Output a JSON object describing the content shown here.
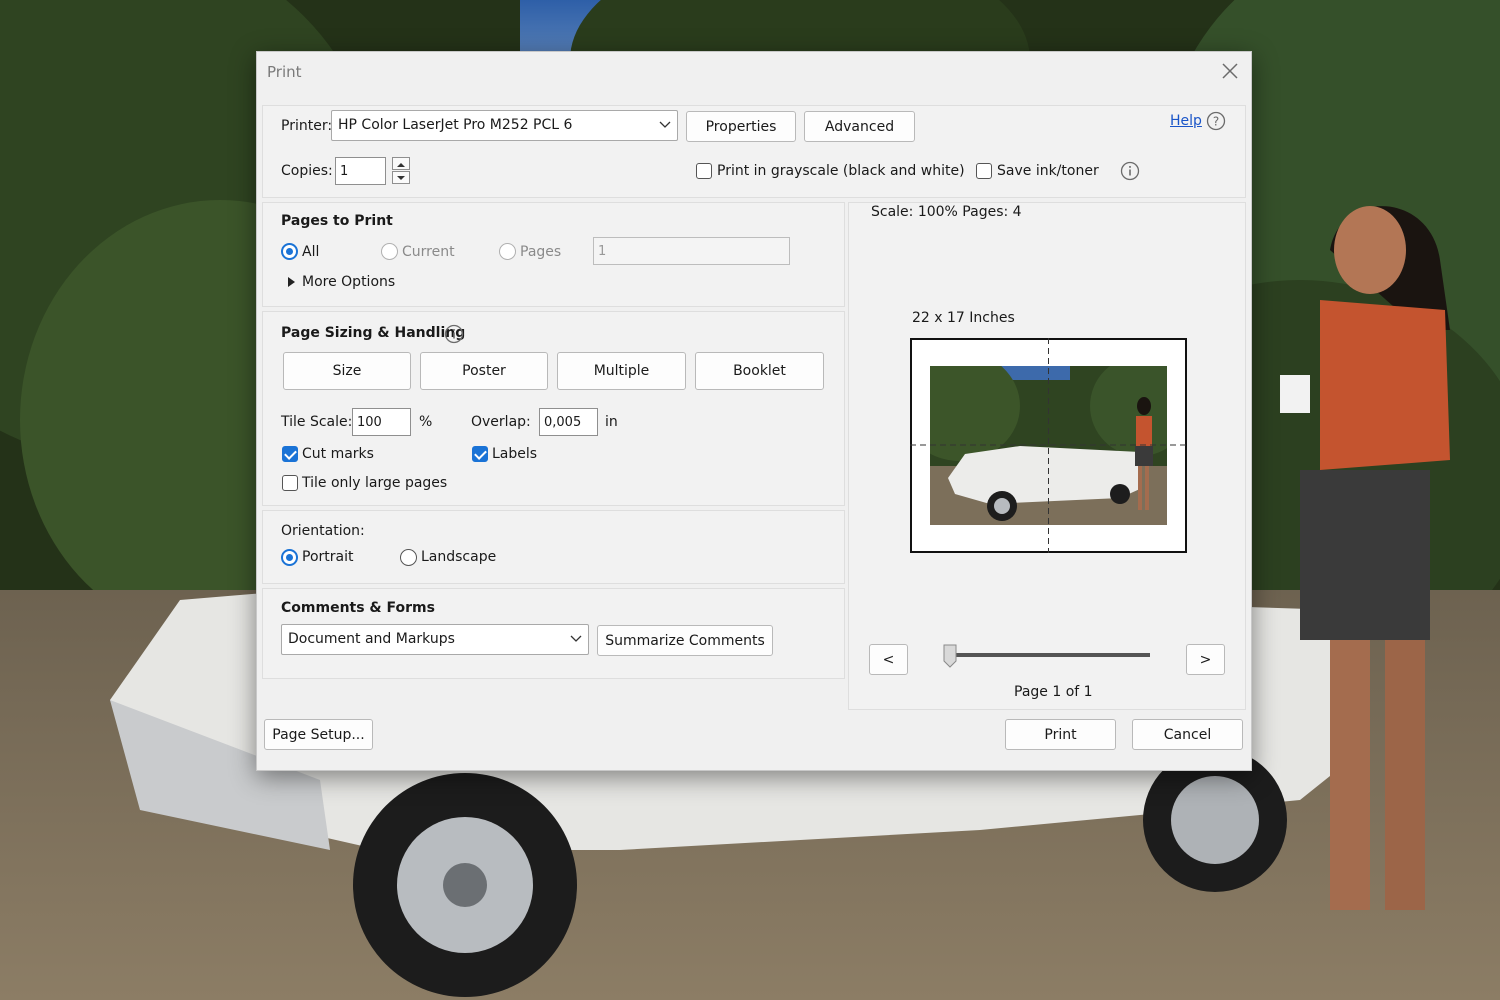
{
  "dialog": {
    "title": "Print"
  },
  "printer": {
    "label": "Printer:",
    "selected": "HP Color LaserJet Pro M252 PCL 6",
    "properties_label": "Properties",
    "advanced_label": "Advanced",
    "help_label": "Help",
    "copies_label": "Copies:",
    "copies_value": "1",
    "grayscale_label": "Print in grayscale (black and white)",
    "grayscale_checked": false,
    "save_ink_label": "Save ink/toner",
    "save_ink_checked": false
  },
  "pages_to_print": {
    "heading": "Pages to Print",
    "options": [
      {
        "label": "All",
        "selected": true
      },
      {
        "label": "Current",
        "selected": false
      },
      {
        "label": "Pages",
        "selected": false
      }
    ],
    "pages_value": "1",
    "more_options_label": "More Options"
  },
  "page_sizing": {
    "heading": "Page Sizing & Handling",
    "tabs": [
      "Size",
      "Poster",
      "Multiple",
      "Booklet"
    ],
    "tile_scale_label": "Tile Scale:",
    "tile_scale_value": "100",
    "tile_scale_unit": "%",
    "overlap_label": "Overlap:",
    "overlap_value": "0,005",
    "overlap_unit": "in",
    "cut_marks_label": "Cut marks",
    "cut_marks_checked": true,
    "labels_label": "Labels",
    "labels_checked": true,
    "tile_only_large_label": "Tile only large pages",
    "tile_only_large_checked": false
  },
  "orientation": {
    "heading": "Orientation:",
    "portrait_label": "Portrait",
    "landscape_label": "Landscape",
    "selected": "Portrait"
  },
  "comments_forms": {
    "heading": "Comments & Forms",
    "selected": "Document and Markups",
    "summarize_label": "Summarize Comments"
  },
  "preview": {
    "scale_pages": "Scale: 100% Pages: 4",
    "paper_size": "22 x 17 Inches",
    "prev_label": "<",
    "next_label": ">",
    "page_indicator": "Page 1 of 1"
  },
  "footer": {
    "page_setup_label": "Page Setup...",
    "print_label": "Print",
    "cancel_label": "Cancel"
  },
  "colors": {
    "accent": "#1a73d6",
    "link": "#1a55c8",
    "dialog_bg": "#f0f0f0"
  }
}
